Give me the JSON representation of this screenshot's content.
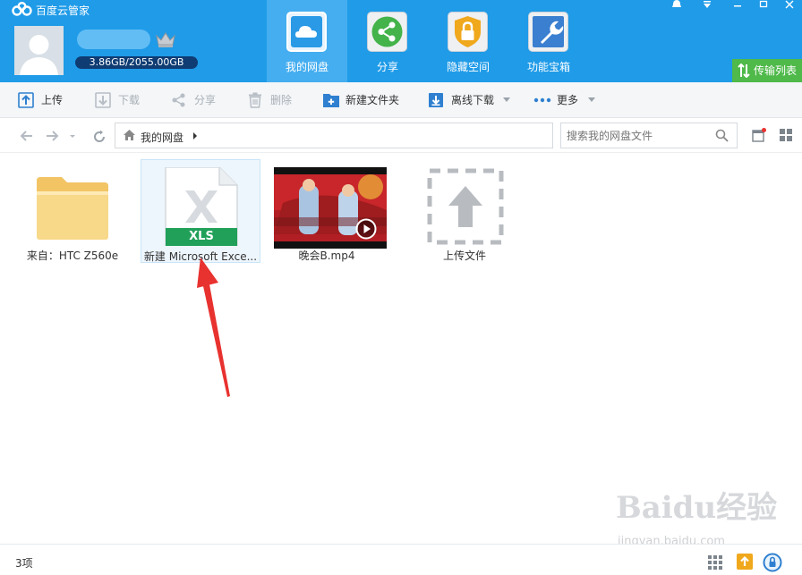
{
  "app": {
    "title": "百度云管家"
  },
  "account": {
    "quota": "3.86GB/2055.00GB"
  },
  "nav_tabs": [
    {
      "label": "我的网盘",
      "icon": "cloud-icon"
    },
    {
      "label": "分享",
      "icon": "share-icon"
    },
    {
      "label": "隐藏空间",
      "icon": "lock-icon"
    },
    {
      "label": "功能宝箱",
      "icon": "wrench-icon"
    }
  ],
  "transfer_list": {
    "label": "传输列表"
  },
  "toolbar": {
    "upload": "上传",
    "download": "下载",
    "share": "分享",
    "delete": "删除",
    "new_folder": "新建文件夹",
    "offline_download": "离线下载",
    "more": "更多"
  },
  "address": {
    "path": "我的网盘"
  },
  "search": {
    "placeholder": "搜索我的网盘文件"
  },
  "files": [
    {
      "name": "来自：HTC Z560e",
      "type": "folder"
    },
    {
      "name": "新建 Microsoft Exce...",
      "type": "xls",
      "badge": "XLS"
    },
    {
      "name": "晚会B.mp4",
      "type": "video"
    },
    {
      "name": "上传文件",
      "type": "upload"
    }
  ],
  "status": {
    "count": "3项"
  },
  "watermark": {
    "brand": "Baidu经验",
    "url": "jingyan.baidu.com"
  },
  "colors": {
    "header": "#1f9be8",
    "active_tab": "#45aef0",
    "transfer": "#4fb94a",
    "arrow": "#e8322f"
  }
}
